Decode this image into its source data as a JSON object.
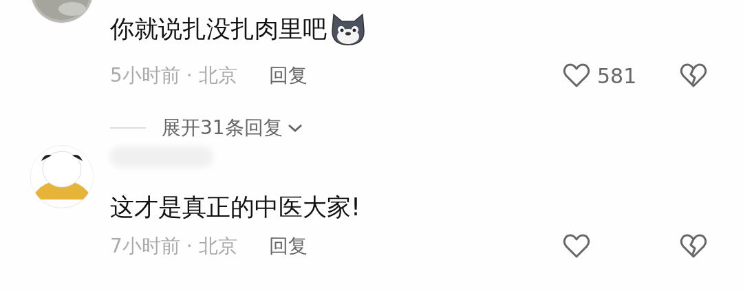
{
  "comments": [
    {
      "text": "你就说扎没扎肉里吧",
      "emoji": true,
      "time_location": "5小时前 · 北京",
      "reply_label": "回复",
      "likes": "581",
      "expand_label": "展开31条回复"
    },
    {
      "username_blurred": true,
      "text": "这才是真正的中医大家!",
      "time_location": "7小时前 · 北京",
      "reply_label": "回复"
    }
  ]
}
